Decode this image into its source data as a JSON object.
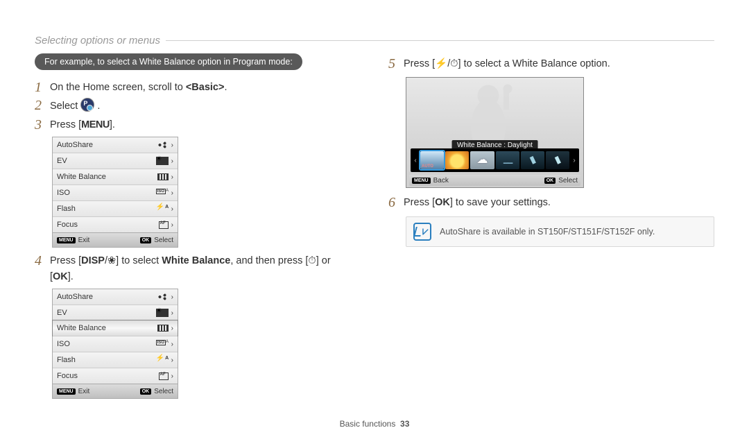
{
  "header": {
    "title": "Selecting options or menus"
  },
  "pill": "For example, to select a White Balance option in Program mode:",
  "steps": {
    "s1_num": "1",
    "s1_a": "On the Home screen, scroll to ",
    "s1_b": "<Basic>",
    "s1_c": ".",
    "s2_num": "2",
    "s2_a": "Select ",
    "s2_b": ".",
    "s3_num": "3",
    "s3_a": "Press [",
    "s3_menu": "MENU",
    "s3_b": "].",
    "s4_num": "4",
    "s4_a": "Press [",
    "s4_disp": "DISP",
    "s4_slash": "/",
    "s4_b": "] to select ",
    "s4_wb": "White Balance",
    "s4_c": ", and then press [",
    "s4_d": "] or",
    "s4_e": "[",
    "s4_ok": "OK",
    "s4_f": "].",
    "s5_num": "5",
    "s5_a": "Press [",
    "s5_slash": "/",
    "s5_b": "] to select a White Balance option.",
    "s6_num": "6",
    "s6_a": "Press [",
    "s6_ok": "OK",
    "s6_b": "] to save your settings."
  },
  "menu": {
    "items": [
      {
        "label": "AutoShare",
        "icon": "autoshare"
      },
      {
        "label": "EV",
        "icon": "ev"
      },
      {
        "label": "White Balance",
        "icon": "wb"
      },
      {
        "label": "ISO",
        "icon": "iso"
      },
      {
        "label": "Flash",
        "icon": "flash"
      },
      {
        "label": "Focus",
        "icon": "focus"
      }
    ],
    "footer_menu_tag": "MENU",
    "footer_exit": "Exit",
    "footer_ok_tag": "OK",
    "footer_select": "Select"
  },
  "menu2_selected_index": 2,
  "wb": {
    "label": "White Balance : Daylight",
    "footer_menu_tag": "MENU",
    "footer_back": "Back",
    "footer_ok_tag": "OK",
    "footer_select": "Select"
  },
  "note": "AutoShare is available in ST150F/ST151F/ST152F only.",
  "footer": {
    "section": "Basic functions",
    "page": "33"
  }
}
